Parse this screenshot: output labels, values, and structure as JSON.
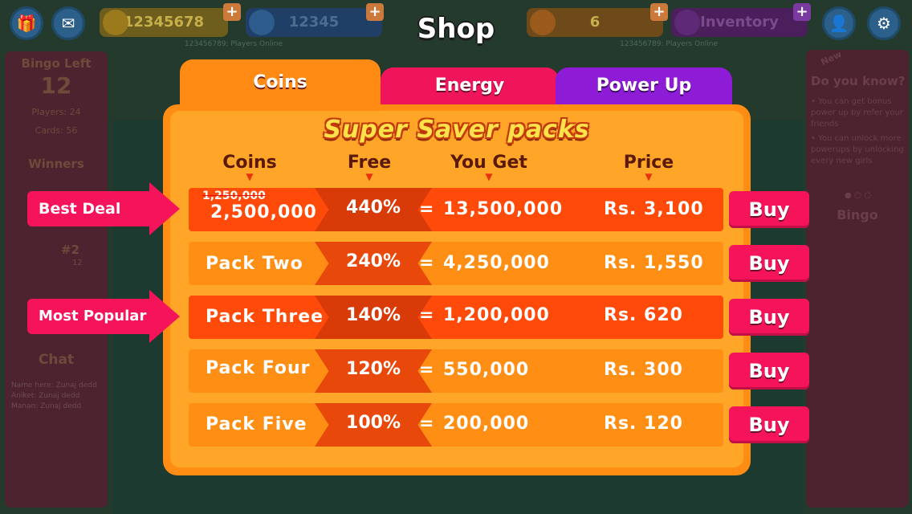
{
  "background": {
    "coins": "12345678",
    "energy": "12345",
    "players_online_left": "123456789: Players Online",
    "energy_level": "6",
    "inventory": "Inventory",
    "players_online_right": "123456789: Players Online",
    "bingo_left_label": "Bingo Left",
    "bingo_left_value": "12",
    "players": "Players: 24",
    "cards": "Cards: 56",
    "winners": "Winners",
    "rank_two": "#2",
    "rank_two_sub": "12",
    "chat_title": "Chat",
    "chat_lines": [
      "Name here: Zunaj dedd",
      "Aniket: Zunaj dedd",
      "Manan: Zunaj dedd"
    ],
    "do_you_know": "Do you know?",
    "new_ribbon": "New",
    "tips": [
      "• You can get bonus power up by refer your friends",
      "• You can unlock more powerups by unlocking every new girls"
    ],
    "bingo_grid_title": "Bingo"
  },
  "shop": {
    "title": "Shop",
    "tabs": [
      {
        "label": "Coins",
        "active": true
      },
      {
        "label": "Energy",
        "active": false
      },
      {
        "label": "Power Up",
        "active": false
      }
    ],
    "section_title": "Super Saver packs",
    "columns": {
      "coins": "Coins",
      "free": "Free",
      "you_get": "You Get",
      "price": "Price"
    },
    "column_arrow": "▼",
    "badges": {
      "best_deal": "Best Deal",
      "most_popular": "Most Popular"
    },
    "rows": [
      {
        "old_coins": "1,250,000",
        "coins": "2,500,000",
        "free": "440%",
        "eq": "=",
        "you_get": "13,500,000",
        "price": "Rs. 3,100",
        "buy": "Buy"
      },
      {
        "name": "Pack Two",
        "free": "240%",
        "eq": "=",
        "you_get": "4,250,000",
        "price": "Rs. 1,550",
        "buy": "Buy"
      },
      {
        "name": "Pack Three",
        "free": "140%",
        "eq": "=",
        "you_get": "1,200,000",
        "price": "Rs. 620",
        "buy": "Buy"
      },
      {
        "name": "Pack Four",
        "free": "120%",
        "eq": "=",
        "you_get": "550,000",
        "price": "Rs. 300",
        "buy": "Buy"
      },
      {
        "name": "Pack Five",
        "free": "100%",
        "eq": "=",
        "you_get": "200,000",
        "price": "Rs. 120",
        "buy": "Buy"
      }
    ]
  },
  "colors": {
    "panel": "#ff8d14",
    "row_red": "#ff4a0a",
    "row_orange": "#ff8f14",
    "buy": "#f5145a",
    "tab_energy": "#f0145a",
    "tab_power": "#8e1bd6"
  }
}
